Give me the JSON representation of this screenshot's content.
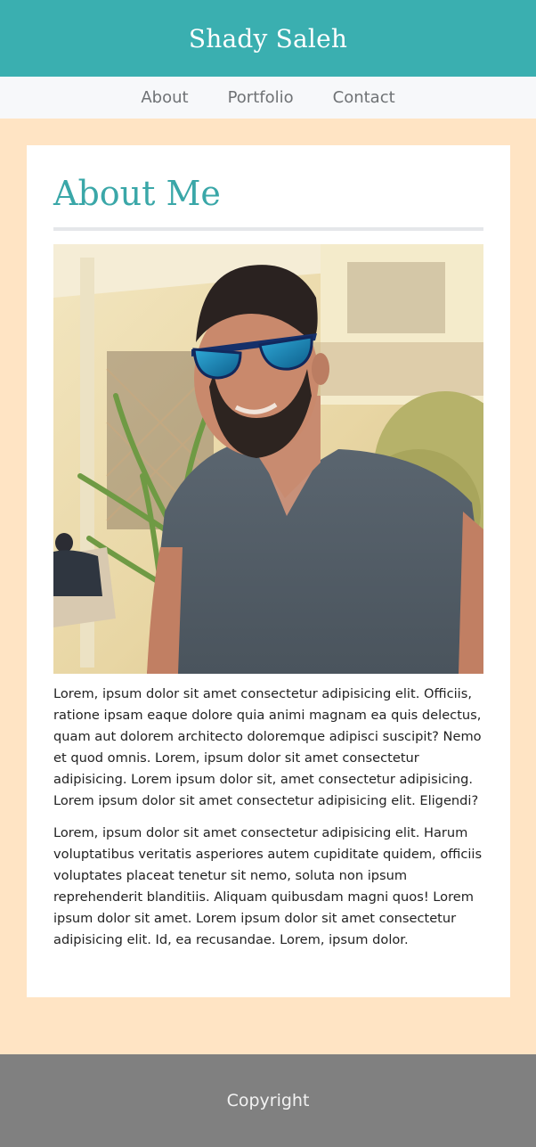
{
  "header": {
    "title": "Shady Saleh"
  },
  "nav": {
    "items": [
      {
        "label": "About"
      },
      {
        "label": "Portfolio"
      },
      {
        "label": "Contact"
      }
    ]
  },
  "about": {
    "heading": "About Me",
    "photo_icon": "profile-photo",
    "paragraphs": [
      "Lorem, ipsum dolor sit amet consectetur adipisicing elit. Officiis, ratione ipsam eaque dolore quia animi magnam ea quis delectus, quam aut dolorem architecto doloremque adipisci suscipit? Nemo et quod omnis. Lorem, ipsum dolor sit amet consectetur adipisicing. Lorem ipsum dolor sit, amet consectetur adipisicing. Lorem ipsum dolor sit amet consectetur adipisicing elit. Eligendi?",
      "Lorem, ipsum dolor sit amet consectetur adipisicing elit. Harum voluptatibus veritatis asperiores autem cupiditate quidem, officiis voluptates placeat tenetur sit nemo, soluta non ipsum reprehenderit blanditiis. Aliquam quibusdam magni quos! Lorem ipsum dolor sit amet. Lorem ipsum dolor sit amet consectetur adipisicing elit. Id, ea recusandae. Lorem, ipsum dolor."
    ]
  },
  "footer": {
    "text": "Copyright"
  },
  "colors": {
    "header_bg": "#3aafb0",
    "nav_bg": "#f7f8fa",
    "page_bg": "#ffe4c4",
    "heading": "#3aa7a8",
    "footer_bg": "#808080"
  }
}
